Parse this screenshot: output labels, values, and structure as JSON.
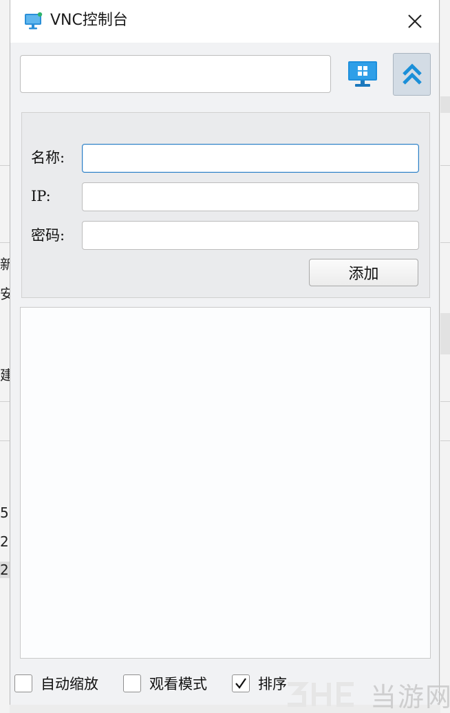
{
  "window": {
    "title": "VNC控制台",
    "close_glyph": "✕"
  },
  "toolbar": {
    "search_value": "",
    "monitor_icon": "monitor-icon",
    "collapse_icon": "double-chevron-up-icon"
  },
  "form": {
    "name_label": "名称:",
    "ip_label": "IP:",
    "password_label": "密码:",
    "name_value": "",
    "ip_value": "",
    "password_value": "",
    "add_button": "添加"
  },
  "list": {
    "items": []
  },
  "footer": {
    "auto_zoom": {
      "label": "自动缩放",
      "checked": false
    },
    "view_mode": {
      "label": "观看模式",
      "checked": false
    },
    "sort": {
      "label": "排序",
      "checked": true
    }
  },
  "watermark": {
    "text": "当游网"
  },
  "background": {
    "fragments": [
      "新",
      "安",
      "建",
      "5:",
      "2",
      "2"
    ]
  },
  "colors": {
    "accent": "#1f8fd6",
    "focus_border": "#2b7fc6",
    "collapse_button_bg": "#d3dce5"
  }
}
